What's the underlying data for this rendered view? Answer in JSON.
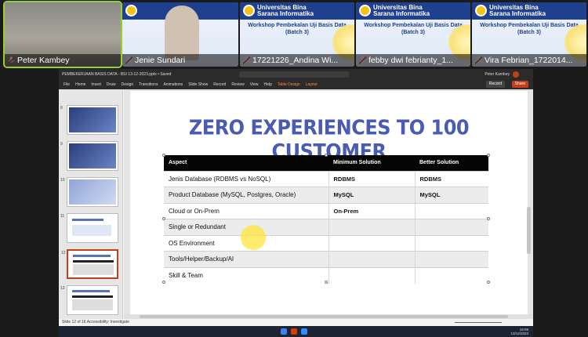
{
  "gallery": {
    "participants": [
      {
        "name": "Peter Kambey",
        "kind": "person",
        "active": true
      },
      {
        "name": "Jenie Sundari",
        "kind": "person",
        "active": false
      },
      {
        "name": "17221226_Andina Wi...",
        "kind": "poster",
        "active": false
      },
      {
        "name": "febby dwi febrianty_1...",
        "kind": "poster",
        "active": false
      },
      {
        "name": "Vira Febrian_1722014...",
        "kind": "poster",
        "active": false
      }
    ],
    "poster": {
      "university": "Universitas Bina Sarana Informatika",
      "workshop": "Workshop Pembekalan Uji Basis Data",
      "batch": "(Batch 3)"
    }
  },
  "app": {
    "window_title": "PEMBEKERJAAN BASIS DATA - BSI 13-12-2023.pptx • Saved",
    "user": "Peter Kambey",
    "menu": [
      "File",
      "Home",
      "Insert",
      "Draw",
      "Design",
      "Transitions",
      "Animations",
      "Slide Show",
      "Record",
      "Review",
      "View",
      "Help",
      "Table Design",
      "Layout"
    ],
    "record_label": "Record",
    "share_label": "Share",
    "status_left": "Slide 12 of 16    Accessibility: Investigate"
  },
  "thumbnails": [
    {
      "num": "8",
      "style": "dark"
    },
    {
      "num": "9",
      "style": "dark"
    },
    {
      "num": "10",
      "style": "light"
    },
    {
      "num": "11",
      "style": "light"
    },
    {
      "num": "12",
      "style": "light"
    },
    {
      "num": "13",
      "style": "light"
    }
  ],
  "slide": {
    "title": "ZERO EXPERIENCES TO 100 CUSTOMER",
    "headers": [
      "Aspect",
      "Minimum Solution",
      "Better Solution"
    ],
    "rows": [
      [
        "Jenis Database (RDBMS vs NoSQL)",
        "RDBMS",
        "RDBMS"
      ],
      [
        "Product Database (MySQL, Postgres, Oracle)",
        "MySQL",
        "MySQL"
      ],
      [
        "Cloud or On-Prem",
        "On-Prem",
        ""
      ],
      [
        "Single or Redundant",
        "",
        ""
      ],
      [
        "OS Environment",
        "",
        ""
      ],
      [
        "Tools/Helper/Backup/AI",
        "",
        ""
      ],
      [
        "Skill & Team",
        "",
        ""
      ]
    ]
  },
  "taskbar": {
    "time": "19:09",
    "date": "13/12/2023"
  }
}
